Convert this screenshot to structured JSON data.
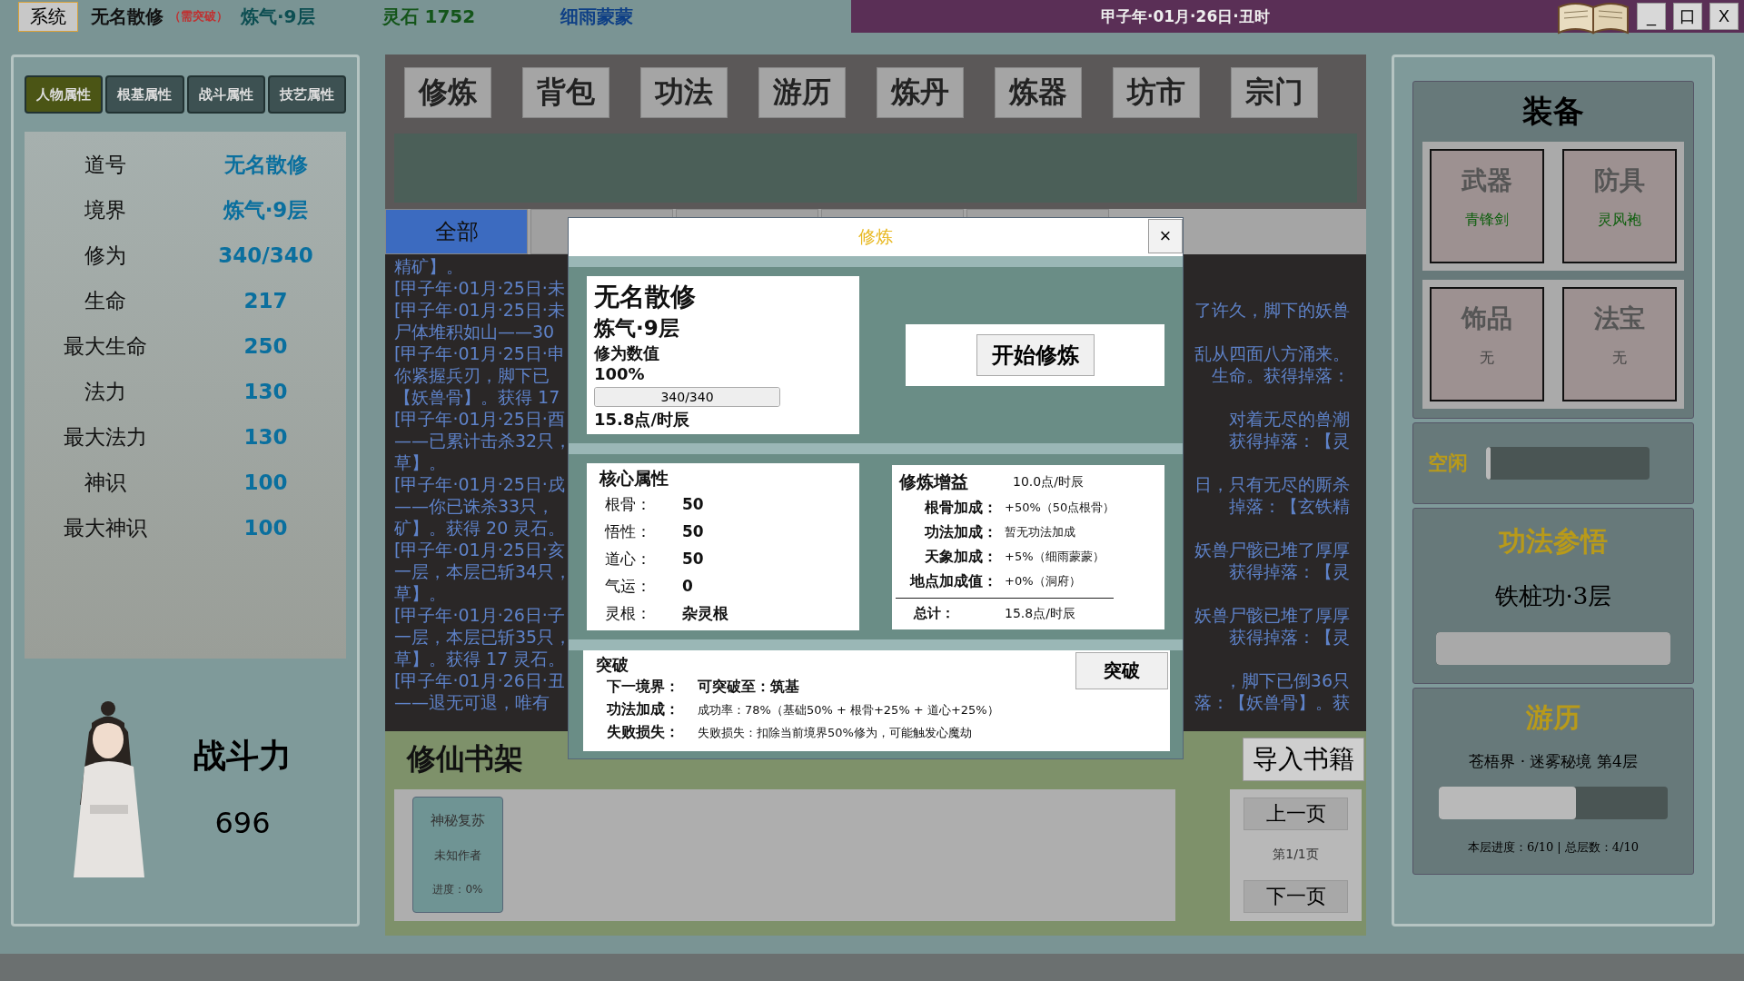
{
  "top_bar": {
    "system_button": "系统",
    "player_name": "无名散修",
    "status_tag": "（需突破）",
    "realm": "炼气·9层",
    "spirit_stones": "灵石 1752",
    "weather": "细雨蒙蒙",
    "datetime": "甲子年·01月·26日·丑时",
    "window_buttons": [
      "_",
      "口",
      "X"
    ]
  },
  "left_panel": {
    "tabs": [
      {
        "label": "人物属性",
        "selected": true
      },
      {
        "label": "根基属性",
        "selected": false
      },
      {
        "label": "战斗属性",
        "selected": false
      },
      {
        "label": "技艺属性",
        "selected": false
      }
    ],
    "stats": [
      {
        "label": "道号",
        "value": "无名散修"
      },
      {
        "label": "境界",
        "value": "炼气·9层"
      },
      {
        "label": "修为",
        "value": "340/340"
      },
      {
        "label": "生命",
        "value": "217"
      },
      {
        "label": "最大生命",
        "value": "250"
      },
      {
        "label": "法力",
        "value": "130"
      },
      {
        "label": "最大法力",
        "value": "130"
      },
      {
        "label": "神识",
        "value": "100"
      },
      {
        "label": "最大神识",
        "value": "100"
      }
    ],
    "combat_power": {
      "label": "战斗力",
      "value": "696"
    }
  },
  "nav_buttons": [
    "修炼",
    "背包",
    "功法",
    "游历",
    "炼丹",
    "炼器",
    "坊市",
    "宗门"
  ],
  "log_tabs": [
    {
      "label": "全部",
      "selected": true
    },
    {
      "selected": false
    },
    {
      "selected": false
    },
    {
      "selected": false
    },
    {
      "selected": false
    }
  ],
  "log_lines": [
    {
      "left": "精矿】。"
    },
    {
      "left": "[甲子年·01月·25日·未"
    },
    {
      "left": "[甲子年·01月·25日·未",
      "right": "了许久，脚下的妖兽"
    },
    {
      "left": "尸体堆积如山——30"
    },
    {
      "left": "[甲子年·01月·25日·申",
      "right": "乱从四面八方涌来。"
    },
    {
      "left": "你紧握兵刃，脚下已",
      "right": "生命。获得掉落："
    },
    {
      "left": "【妖兽骨】。获得 17"
    },
    {
      "left": "[甲子年·01月·25日·酉",
      "right": "对着无尽的兽潮"
    },
    {
      "left": "——已累计击杀32只，",
      "right": "获得掉落：【灵"
    },
    {
      "left": "草】。"
    },
    {
      "left": "[甲子年·01月·25日·戌",
      "right": "日，只有无尽的厮杀"
    },
    {
      "left": "——你已诛杀33只，",
      "right": "掉落：【玄铁精"
    },
    {
      "left": "矿】。获得 20 灵石。"
    },
    {
      "left": "[甲子年·01月·25日·亥",
      "right": "妖兽尸骸已堆了厚厚"
    },
    {
      "left": "一层，本层已斩34只，",
      "right": "获得掉落：【灵"
    },
    {
      "left": "草】。"
    },
    {
      "left": "[甲子年·01月·26日·子",
      "right": "妖兽尸骸已堆了厚厚"
    },
    {
      "left": "一层，本层已斩35只，",
      "right": "获得掉落：【灵"
    },
    {
      "left": "草】。获得 17 灵石。"
    },
    {
      "left": "[甲子年·01月·26日·丑",
      "right": "，脚下已倒36只"
    },
    {
      "left": "——退无可退，唯有",
      "right": "落：【妖兽骨】。获"
    }
  ],
  "modal": {
    "title": "修炼",
    "close": "×",
    "summary": {
      "name": "无名散修",
      "realm": "炼气·9层",
      "label": "修为数值",
      "percent": "100%",
      "bar_text": "340/340",
      "level": 1,
      "rate": "15.8点/时辰"
    },
    "start_button": "开始修炼",
    "core": {
      "title": "核心属性",
      "rows": [
        {
          "label": "根骨：",
          "value": "50"
        },
        {
          "label": "悟性：",
          "value": "50"
        },
        {
          "label": "道心：",
          "value": "50"
        },
        {
          "label": "气运：",
          "value": "0"
        },
        {
          "label": "灵根：",
          "value": "杂灵根"
        }
      ]
    },
    "gains": {
      "title": "修炼增益",
      "base": "10.0点/时辰",
      "rows": [
        {
          "label": "根骨加成：",
          "value": "+50%（50点根骨）"
        },
        {
          "label": "功法加成：",
          "value": "暂无功法加成"
        },
        {
          "label": "天象加成：",
          "value": "+5%（细雨蒙蒙）"
        },
        {
          "label": "地点加成值：",
          "value": "+0%（洞府）"
        }
      ],
      "total_label": "总计：",
      "total": "15.8点/时辰"
    },
    "breakthrough": {
      "title": "突破",
      "button": "突破",
      "rows": [
        {
          "label": "下一境界：",
          "value": "可突破至：筑基"
        },
        {
          "label": "功法加成：",
          "value": "成功率：78%（基础50% + 根骨+25% + 道心+25%）"
        },
        {
          "label": "失败损失：",
          "value": "失败损失：扣除当前境界50%修为，可能触发心魔劫"
        }
      ]
    }
  },
  "bookshelf": {
    "title": "修仙书架",
    "import_button": "导入书籍",
    "books": [
      {
        "title": "神秘复苏",
        "author": "未知作者",
        "progress": "进度：0%"
      }
    ],
    "prev": "上一页",
    "page": "第1/1页",
    "next": "下一页"
  },
  "right_panel": {
    "equipment_title": "装备",
    "slots": [
      {
        "slot": "武器",
        "item": "青锋剑",
        "equipped": true
      },
      {
        "slot": "防具",
        "item": "灵风袍",
        "equipped": true
      },
      {
        "slot": "饰品",
        "item": "无",
        "equipped": false
      },
      {
        "slot": "法宝",
        "item": "无",
        "equipped": false
      }
    ],
    "activity": {
      "label": "空闲",
      "level": 0.03
    },
    "technique": {
      "title": "功法参悟",
      "name": "铁桩功·3层",
      "level": 1
    },
    "travel": {
      "title": "游历",
      "location": "苍梧界 · 迷雾秘境 第4层",
      "level": 0.6,
      "progress": "本层进度：6/10 | 总层数：4/10"
    }
  }
}
